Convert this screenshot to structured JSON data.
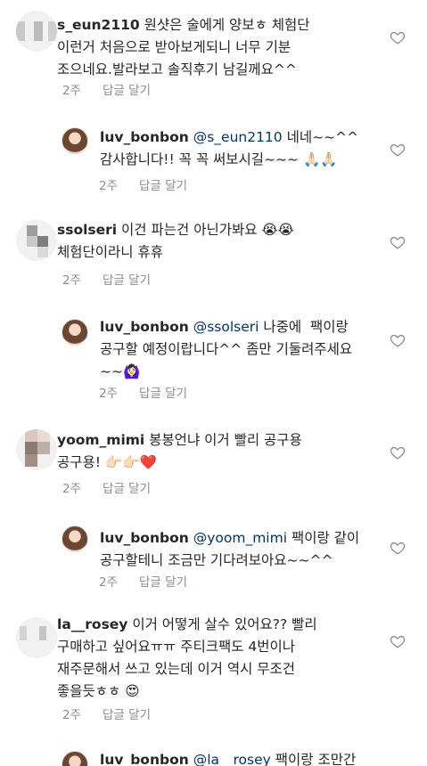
{
  "comments": [
    {
      "username": "s_eun2110",
      "text": " 원샷은 술에게 양보ㅎ 체험단\n이런거 처음으로 받아보게되니 너무 기분\n조으네요.발라보고 솔직후기 남길께요^^",
      "time": "2주",
      "reply_label": "답글 달기"
    },
    {
      "username": "luv_bonbon",
      "mention": "@s_eun2110",
      "text": " 네네~~^^\n감사합니다!! 꼭 꼭 써보시길~~~ 🙏🏻🙏🏻",
      "time": "2주",
      "reply_label": "답글 달기"
    },
    {
      "username": "ssolseri",
      "text": " 이건 파는건 아닌가봐요 😭😭\n체험단이라니 휴휴",
      "time": "2주",
      "reply_label": "답글 달기"
    },
    {
      "username": "luv_bonbon",
      "mention": "@ssolseri",
      "text": " 나중에  팩이랑\n공구할 예정이랍니다^^ 좀만 기둘려주세요\n~~🙆🏻‍♀️",
      "time": "2주",
      "reply_label": "답글 달기"
    },
    {
      "username": "yoom_mimi",
      "text": " 봉봉언냐 이거 빨리 공구용\n공구용! 👉🏻👉🏻❤️",
      "time": "2주",
      "reply_label": "답글 달기"
    },
    {
      "username": "luv_bonbon",
      "mention": "@yoom_mimi",
      "text": " 팩이랑 같이\n공구할테니 조금만 기다려보아요~~^^",
      "time": "2주",
      "reply_label": "답글 달기"
    },
    {
      "username": "la__rosey",
      "text": " 이거 어떻게 살수 있어요?? 빨리\n구매하고 싶어요ㅠㅠ 주티크팩도 4번이나\n재주문해서 쓰고 있는데 이거 역시 무조건\n좋을듯ㅎㅎ 😍",
      "time": "2주",
      "reply_label": "답글 달기"
    },
    {
      "username": "luv_bonbon",
      "mention": "@la__rosey",
      "text": " 팩이랑 조만간",
      "time": "",
      "reply_label": ""
    }
  ],
  "icons": {
    "like": "heart-outline-icon"
  }
}
